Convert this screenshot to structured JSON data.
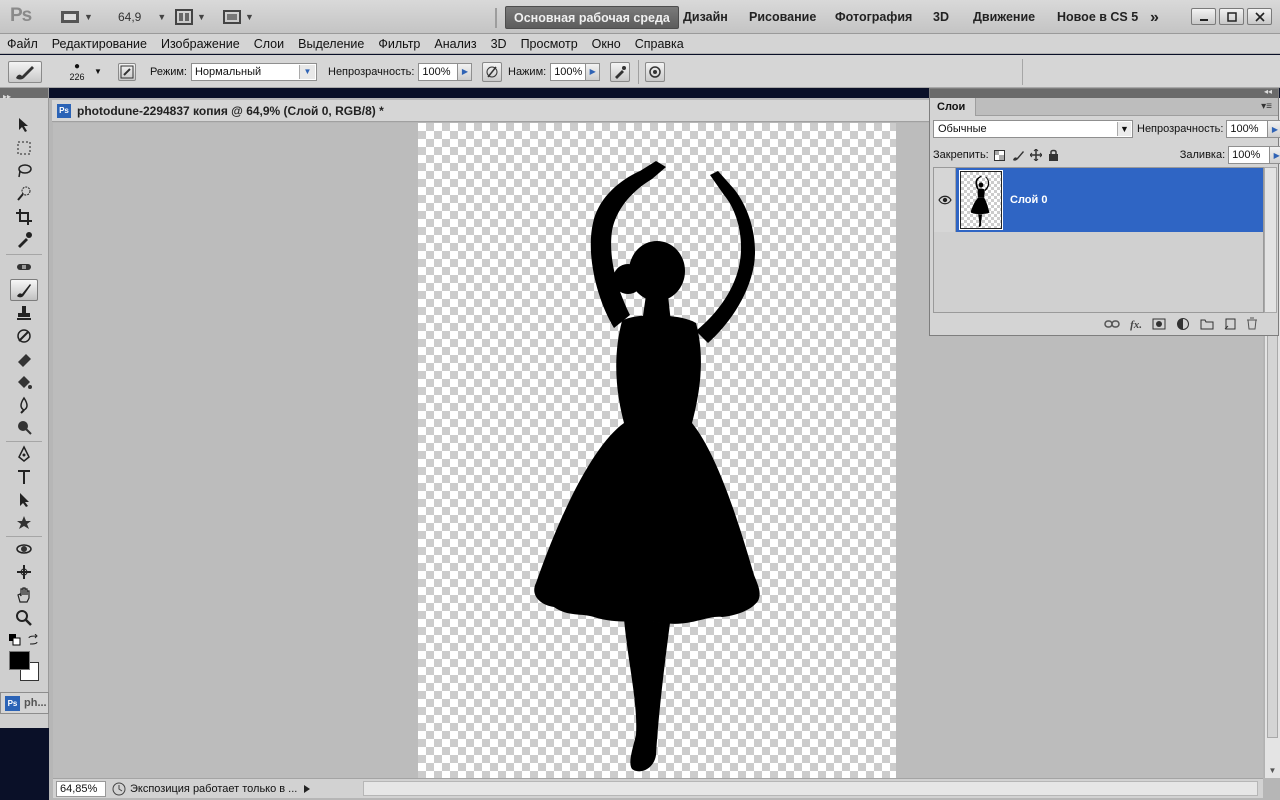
{
  "appbar": {
    "logo": "Ps",
    "zoom": "64,9",
    "workspaces": [
      "Основная рабочая среда",
      "Дизайн",
      "Рисование",
      "Фотография",
      "3D",
      "Движение",
      "Новое в CS 5"
    ],
    "overflow": "»"
  },
  "menu": [
    "Файл",
    "Редактирование",
    "Изображение",
    "Слои",
    "Выделение",
    "Фильтр",
    "Анализ",
    "3D",
    "Просмотр",
    "Окно",
    "Справка"
  ],
  "options": {
    "brush_size": "226",
    "mode_label": "Режим:",
    "mode_value": "Нормальный",
    "opacity_label": "Непрозрачность:",
    "opacity_value": "100%",
    "flow_label": "Нажим:",
    "flow_value": "100%"
  },
  "document": {
    "title": "photodune-2294837 копия @ 64,9% (Слой 0, RGB/8) *",
    "zoom": "64,85%",
    "status": "Экспозиция работает только в ...",
    "minimized_label": "ph..."
  },
  "layers": {
    "tab": "Слои",
    "blend_mode": "Обычные",
    "opacity_label": "Непрозрачность:",
    "opacity_value": "100%",
    "lock_label": "Закрепить:",
    "fill_label": "Заливка:",
    "fill_value": "100%",
    "items": [
      {
        "name": "Слой 0",
        "visible": true,
        "selected": true
      }
    ]
  },
  "colors": {
    "accent": "#2f65c4",
    "foreground": "#000000",
    "background": "#ffffff"
  }
}
